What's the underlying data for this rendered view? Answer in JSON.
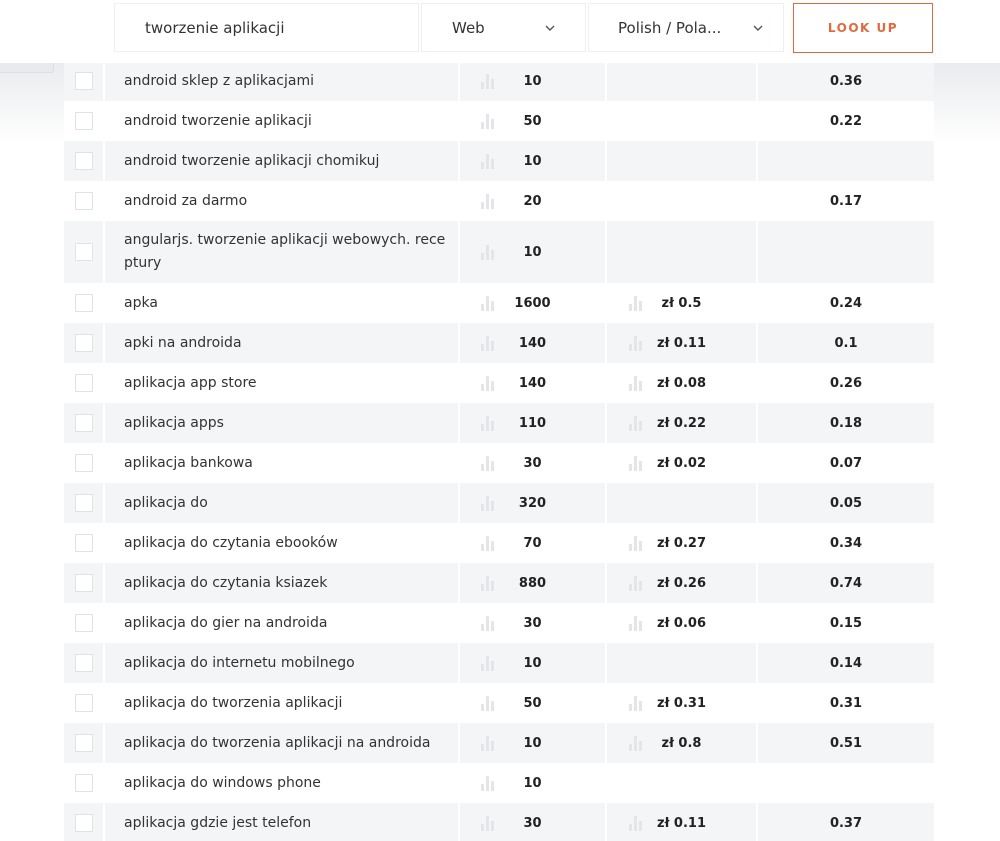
{
  "search": {
    "query": "tworzenie aplikacji",
    "source": "Web",
    "language": "Polish / Pola...",
    "button_label": "LOOK UP"
  },
  "icons": {
    "chevron": "chevron-down-icon",
    "trend": "bar-chart-icon"
  },
  "colors": {
    "accent": "#e06a3d",
    "row_shade": "#f4f5f7",
    "icon_gray": "#e3e5e8"
  },
  "rows": [
    {
      "keyword": "android sklep z aplikacjami",
      "volume": "10",
      "cpc": "",
      "competition": "0.36"
    },
    {
      "keyword": "android tworzenie aplikacji",
      "volume": "50",
      "cpc": "",
      "competition": "0.22"
    },
    {
      "keyword": "android tworzenie aplikacji chomikuj",
      "volume": "10",
      "cpc": "",
      "competition": ""
    },
    {
      "keyword": "android za darmo",
      "volume": "20",
      "cpc": "",
      "competition": "0.17"
    },
    {
      "keyword": "angularjs. tworzenie aplikacji webowych. rece ptury",
      "volume": "10",
      "cpc": "",
      "competition": ""
    },
    {
      "keyword": "apka",
      "volume": "1600",
      "cpc": "zł 0.5",
      "competition": "0.24"
    },
    {
      "keyword": "apki na androida",
      "volume": "140",
      "cpc": "zł 0.11",
      "competition": "0.1"
    },
    {
      "keyword": "aplikacja app store",
      "volume": "140",
      "cpc": "zł 0.08",
      "competition": "0.26"
    },
    {
      "keyword": "aplikacja apps",
      "volume": "110",
      "cpc": "zł 0.22",
      "competition": "0.18"
    },
    {
      "keyword": "aplikacja bankowa",
      "volume": "30",
      "cpc": "zł 0.02",
      "competition": "0.07"
    },
    {
      "keyword": "aplikacja do",
      "volume": "320",
      "cpc": "",
      "competition": "0.05"
    },
    {
      "keyword": "aplikacja do czytania ebooków",
      "volume": "70",
      "cpc": "zł 0.27",
      "competition": "0.34"
    },
    {
      "keyword": "aplikacja do czytania ksiazek",
      "volume": "880",
      "cpc": "zł 0.26",
      "competition": "0.74"
    },
    {
      "keyword": "aplikacja do gier na androida",
      "volume": "30",
      "cpc": "zł 0.06",
      "competition": "0.15"
    },
    {
      "keyword": "aplikacja do internetu mobilnego",
      "volume": "10",
      "cpc": "",
      "competition": "0.14"
    },
    {
      "keyword": "aplikacja do tworzenia aplikacji",
      "volume": "50",
      "cpc": "zł 0.31",
      "competition": "0.31"
    },
    {
      "keyword": "aplikacja do tworzenia aplikacji na androida",
      "volume": "10",
      "cpc": "zł 0.8",
      "competition": "0.51"
    },
    {
      "keyword": "aplikacja do windows phone",
      "volume": "10",
      "cpc": "",
      "competition": ""
    },
    {
      "keyword": "aplikacja gdzie jest telefon",
      "volume": "30",
      "cpc": "zł 0.11",
      "competition": "0.37"
    }
  ]
}
